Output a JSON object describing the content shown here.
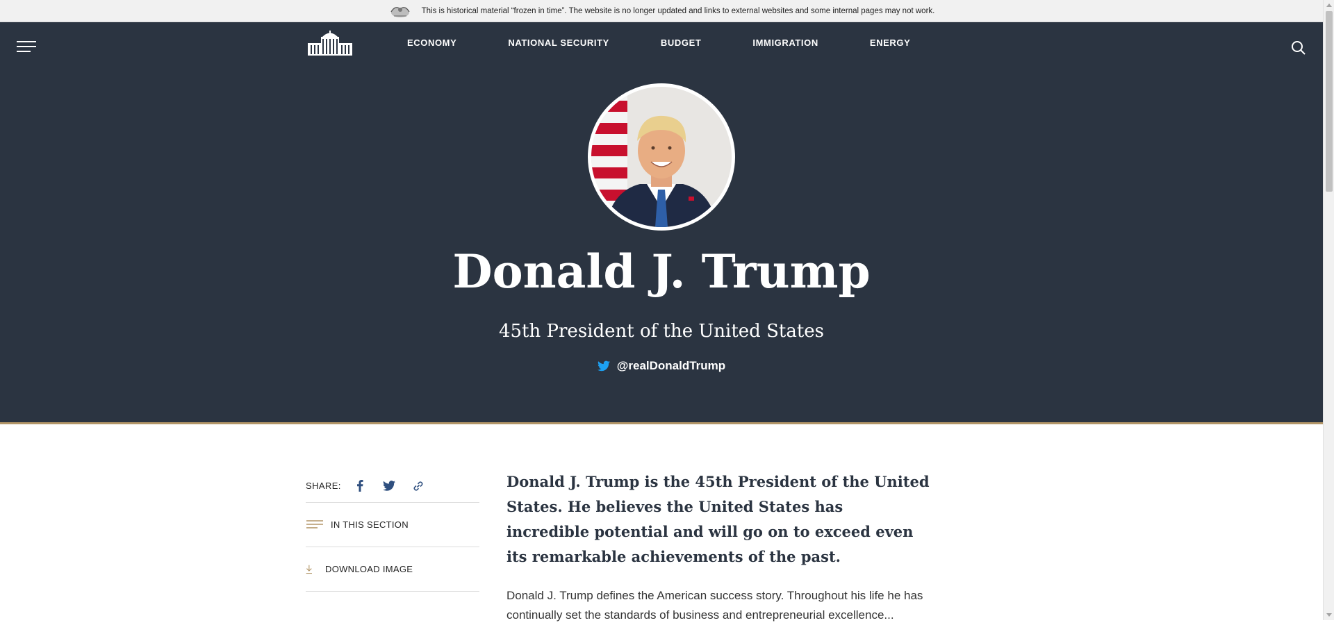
{
  "archive_banner": {
    "text": "This is historical material “frozen in time”. The website is no longer updated and links to external websites and some internal pages may not work."
  },
  "nav": {
    "items": [
      "ECONOMY",
      "NATIONAL SECURITY",
      "BUDGET",
      "IMMIGRATION",
      "ENERGY"
    ]
  },
  "hero": {
    "name": "Donald J. Trump",
    "subtitle": "45th President of the United States",
    "twitter_handle": "@realDonaldTrump"
  },
  "sidebar": {
    "share_label": "SHARE:",
    "share_icons": [
      "facebook-icon",
      "twitter-icon",
      "link-icon"
    ],
    "items": [
      {
        "label": "IN THIS SECTION",
        "icon": "list-icon"
      },
      {
        "label": "DOWNLOAD IMAGE",
        "icon": "download-icon"
      }
    ]
  },
  "article": {
    "lead": "Donald J. Trump is the 45th President of the United States. He believes the United States has incredible potential and will go on to exceed even its remarkable achievements of the past.",
    "body": "Donald J. Trump defines the American success story. Throughout his life he has continually set the standards of business and entrepreneurial excellence..."
  },
  "colors": {
    "hero_bg": "#2b3441",
    "accent_gold": "#b39668",
    "twitter_blue": "#1da1f2",
    "share_icon_blue": "#2f4f7f"
  }
}
